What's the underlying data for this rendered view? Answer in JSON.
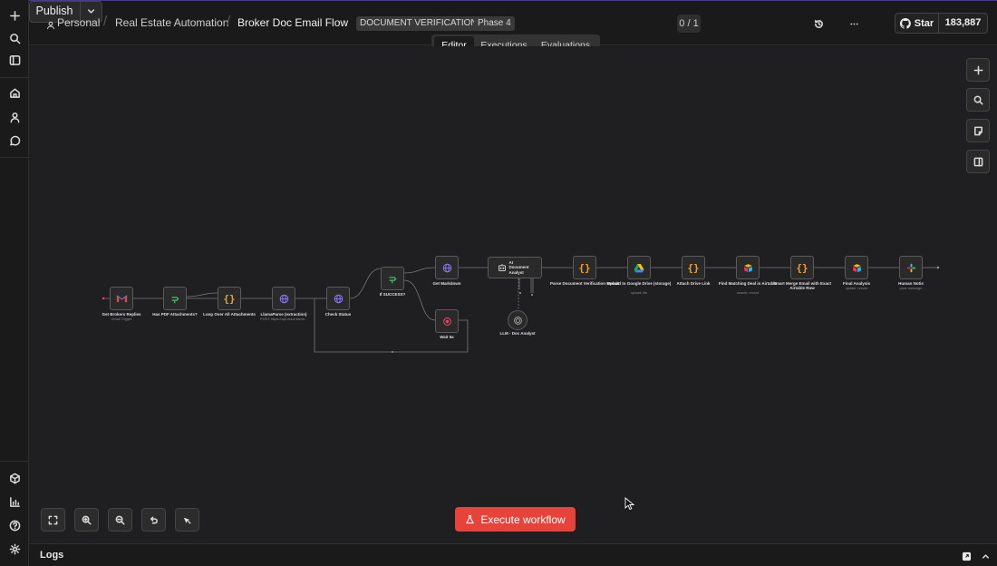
{
  "breadcrumb": {
    "project": "Personal",
    "folder": "Real Estate Automation",
    "workflow": "Broker Doc Email Flow"
  },
  "tags": [
    "DOCUMENT VERIFICATION",
    "Phase 4"
  ],
  "header": {
    "counter": "0 / 1",
    "publish_label": "Publish",
    "github_star_label": "Star",
    "github_star_count": "183,887"
  },
  "tabs": [
    {
      "label": "Editor",
      "active": true
    },
    {
      "label": "Executions",
      "active": false
    },
    {
      "label": "Evaluations",
      "active": false
    }
  ],
  "nodes": [
    {
      "label": "Get Brokers Replies",
      "sub": "Gmail Trigger",
      "icon": "gmail-icon"
    },
    {
      "label": "Has PDF Attachments?",
      "sub": "",
      "icon": "if-icon"
    },
    {
      "label": "Loop Over All Attachments",
      "sub": "",
      "icon": "code-icon"
    },
    {
      "label": "LlamaParse (extraction)",
      "sub": "POST: https://api.cloud.llama...",
      "icon": "globe-icon"
    },
    {
      "label": "Check Status",
      "sub": "",
      "icon": "globe-icon"
    },
    {
      "label": "If SUCCESS?",
      "sub": "",
      "icon": "if-icon"
    },
    {
      "label": "Get Markdown",
      "sub": "",
      "icon": "globe-icon"
    },
    {
      "label": "Wait 5s",
      "sub": "",
      "icon": "wait-icon"
    },
    {
      "label": "AI Document Analyst",
      "sub": "",
      "icon": "robot-icon"
    },
    {
      "label": "LLM - Doc Analyst",
      "sub": "",
      "icon": "llm-icon"
    },
    {
      "label": "Parse Document Verification Result",
      "sub": "",
      "icon": "code-icon"
    },
    {
      "label": "Upload to Google Drive (storage)",
      "sub": "upload: file",
      "icon": "google-drive-icon"
    },
    {
      "label": "Attach Drive Link",
      "sub": "",
      "icon": "code-icon"
    },
    {
      "label": "Find Matching Deal in Airtable",
      "sub": "search: record",
      "icon": "airtable-icon"
    },
    {
      "label": "Smart Merge Email with Exact Airtable Row",
      "sub": "",
      "icon": "code-icon"
    },
    {
      "label": "Final Analysis",
      "sub": "update: record",
      "icon": "airtable-icon"
    },
    {
      "label": "Human Notis",
      "sub": "post: message",
      "icon": "slack-icon"
    }
  ],
  "execute_label": "Execute workflow",
  "logs_label": "Logs",
  "colors": {
    "accent_red": "#e8433b",
    "if_green": "#3ec46d",
    "code_orange": "#f0a030",
    "globe_purple": "#8a7cf5",
    "wait_pink": "#e04a6a"
  }
}
